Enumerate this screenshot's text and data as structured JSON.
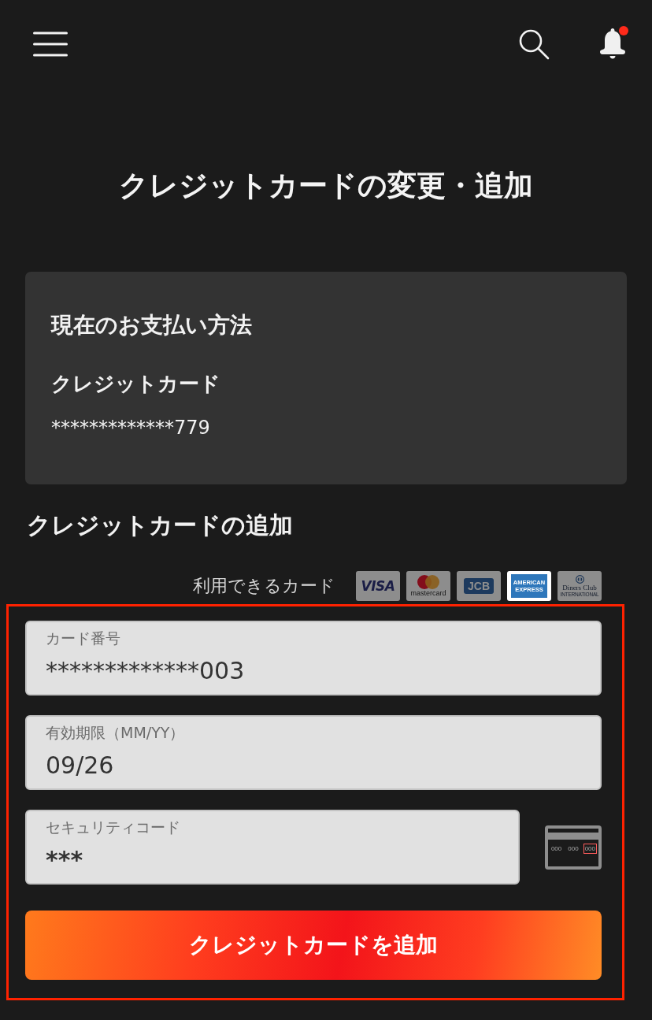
{
  "header": {
    "notification": true
  },
  "title": "クレジットカードの変更・追加",
  "current_payment": {
    "heading": "現在のお支払い方法",
    "method": "クレジットカード",
    "number": "*************779"
  },
  "add_card": {
    "heading": "クレジットカードの追加",
    "accepted_label": "利用できるカード",
    "cards": [
      {
        "kind": "visa",
        "lines": [
          "VISA"
        ],
        "selected": false
      },
      {
        "kind": "mastercard",
        "lines": [
          "mastercard"
        ],
        "selected": false
      },
      {
        "kind": "jcb",
        "lines": [
          "JCB"
        ],
        "selected": false
      },
      {
        "kind": "amex",
        "lines": [
          "AMERICAN",
          "EXPRESS"
        ],
        "selected": true
      },
      {
        "kind": "diners",
        "lines": [
          "Diners Club",
          "INTERNATIONAL"
        ],
        "selected": false
      }
    ],
    "fields": [
      {
        "kind": "text",
        "label": "カード番号",
        "value": "*************003"
      },
      {
        "kind": "text",
        "label": "有効期限（MM/YY）",
        "value": "09/26"
      },
      {
        "kind": "security",
        "label": "セキュリティコード",
        "value": "***"
      }
    ],
    "cvc_hint": [
      {
        "text": "000",
        "selected": false
      },
      {
        "text": "000",
        "selected": false
      },
      {
        "text": "000",
        "selected": true
      }
    ],
    "submit": "クレジットカードを追加"
  }
}
